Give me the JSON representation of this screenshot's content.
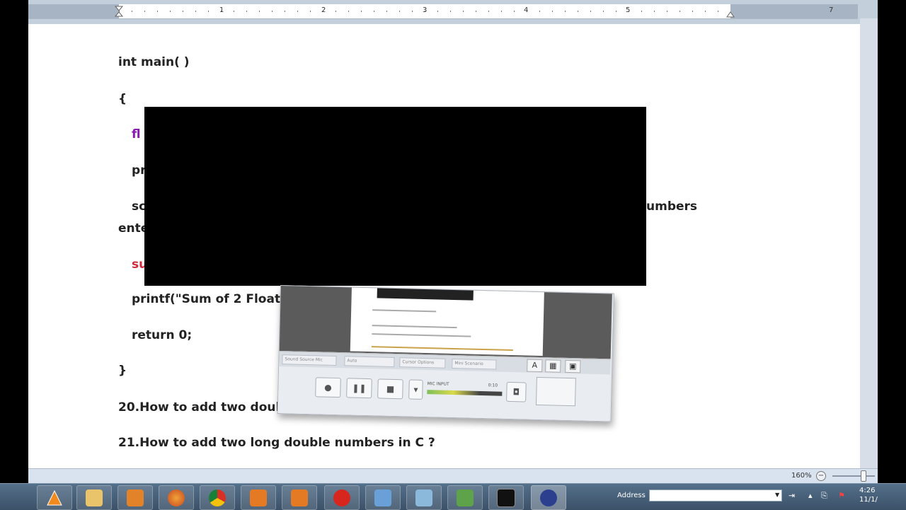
{
  "ruler": {
    "numbers": [
      "1",
      "2",
      "3",
      "4",
      "5",
      "7"
    ]
  },
  "document": {
    "lines": [
      "int main( )",
      "{",
      "fl",
      "pr",
      "sc",
      "umbers",
      "ente",
      "su",
      "printf(\"Sum of 2 Floating Point Numbers: %f\", sumResult);",
      "return 0;",
      "}",
      "20.How to add two double numbers in C ?",
      "21.How to add two long double numbers in C ?"
    ]
  },
  "recorder": {
    "field1": "Sound Source Mic",
    "field2": "Auto",
    "field3": "Cursor Options",
    "field4": "Mini Scenario",
    "meter_left": "MIC INPUT",
    "meter_right": "0:10"
  },
  "statusbar": {
    "zoom_label": "160%",
    "zoom_minus": "−"
  },
  "taskbar": {
    "address_label": "Address",
    "address_value": "",
    "clock_time": "4:26",
    "clock_date": "11/1/"
  },
  "colors": {
    "keyword_purple": "#8a1cb4",
    "keyword_red": "#d0283c",
    "taskbar": "#3b5168"
  }
}
